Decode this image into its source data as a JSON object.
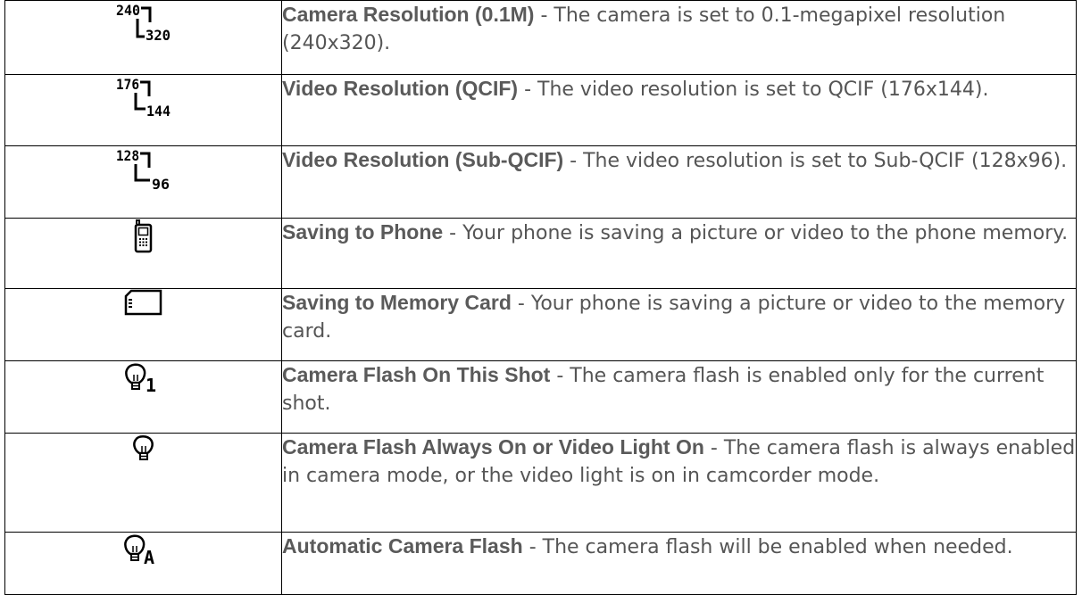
{
  "rows": [
    {
      "icon": "camera-resolution-240x320-icon",
      "icon_text": [
        "240",
        "320"
      ],
      "term": "Camera Resolution (0.1M)",
      "separator": " - ",
      "description": "The camera is set to 0.1-megapixel resolution (240x320)."
    },
    {
      "icon": "video-resolution-176x144-icon",
      "icon_text": [
        "176",
        "144"
      ],
      "term": "Video Resolution (QCIF)",
      "separator": " - ",
      "description": "The video resolution is set to QCIF (176x144)."
    },
    {
      "icon": "video-resolution-128x96-icon",
      "icon_text": [
        "128",
        "96"
      ],
      "term": "Video Resolution (Sub-QCIF)",
      "separator": " - ",
      "description": "The video resolution is set to Sub-QCIF (128x96)."
    },
    {
      "icon": "phone-icon",
      "term": "Saving to Phone",
      "separator": " - ",
      "description": "Your phone is saving a picture or video to the phone memory."
    },
    {
      "icon": "memory-card-icon",
      "term": "Saving to Memory Card",
      "separator": " - ",
      "description": "Your phone is saving a picture or video to the memory card."
    },
    {
      "icon": "flash-one-shot-icon",
      "icon_text": [
        "1"
      ],
      "term": "Camera Flash On This Shot",
      "separator": " - ",
      "description": "The camera flash is enabled only for the current shot."
    },
    {
      "icon": "flash-always-on-icon",
      "term": "Camera Flash Always On or Video Light On",
      "separator": " - ",
      "description": "The camera flash is always enabled in camera mode, or the video light is on in camcorder mode."
    },
    {
      "icon": "flash-auto-icon",
      "icon_text": [
        "A"
      ],
      "term": "Automatic Camera Flash",
      "separator": " - ",
      "description": "The camera flash will be enabled when needed."
    }
  ]
}
